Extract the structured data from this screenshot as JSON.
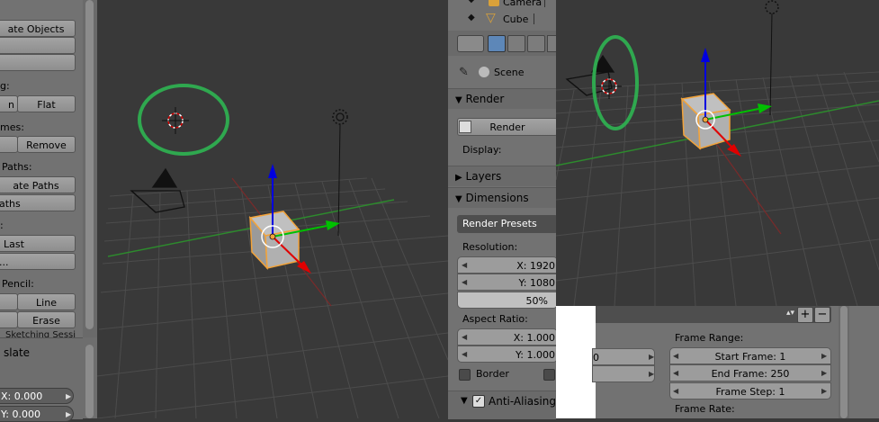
{
  "toolshelf": {
    "items": [
      {
        "type": "button",
        "label": "ate Objects"
      },
      {
        "type": "button",
        "label": ""
      },
      {
        "type": "button",
        "label": ""
      },
      {
        "type": "label",
        "label": "g:"
      },
      {
        "type": "button",
        "label": "n"
      },
      {
        "type": "button",
        "label": "Flat"
      },
      {
        "type": "label",
        "label": "mes:"
      },
      {
        "type": "button",
        "label": ""
      },
      {
        "type": "button",
        "label": "Remove"
      },
      {
        "type": "label",
        "label": "Paths:"
      },
      {
        "type": "button",
        "label": "ate Paths"
      },
      {
        "type": "button",
        "label": "aths"
      },
      {
        "type": "label",
        "label": ":"
      },
      {
        "type": "button",
        "label": "Last"
      },
      {
        "type": "button",
        "label": "..."
      },
      {
        "type": "label",
        "label": "Pencil:"
      },
      {
        "type": "button",
        "label": ""
      },
      {
        "type": "button",
        "label": "Line"
      },
      {
        "type": "button",
        "label": ""
      },
      {
        "type": "button",
        "label": "Erase"
      }
    ],
    "sketching_session_label": "Sketching Sessi",
    "operator_title": "slate",
    "x_field": "X: 0.000",
    "y_field": "Y: 0.000"
  },
  "outliner": {
    "camera_label": "Camera",
    "cube_label": "Cube"
  },
  "properties": {
    "scene_label": "Scene",
    "render_panel": "Render",
    "render_button": "Render",
    "display_label": "Display:",
    "layers_panel": "Layers",
    "dimensions_panel": "Dimensions",
    "render_presets": "Render Presets",
    "resolution_label": "Resolution:",
    "res_x": "X: 1920",
    "res_y": "Y: 1080",
    "res_pct": "50%",
    "aspect_label": "Aspect Ratio:",
    "aspect_x": "X: 1.000",
    "aspect_y": "Y: 1.000",
    "border_label": "Border",
    "antialias_panel": "Anti-Aliasing"
  },
  "frame_panel": {
    "frame_range_label": "Frame Range:",
    "start_frame": "Start Frame: 1",
    "end_frame": "End Frame: 250",
    "frame_step": "Frame Step: 1",
    "frame_rate_label": "Frame Rate:",
    "partial_value": "0"
  },
  "colors": {
    "viewport_bg": "#393939",
    "panel_bg": "#727272",
    "annotation_green": "#2fa84f",
    "axis_x": "#e00000",
    "axis_y": "#00c000",
    "axis_z": "#0000e0",
    "selection_orange": "#f2a33a"
  }
}
